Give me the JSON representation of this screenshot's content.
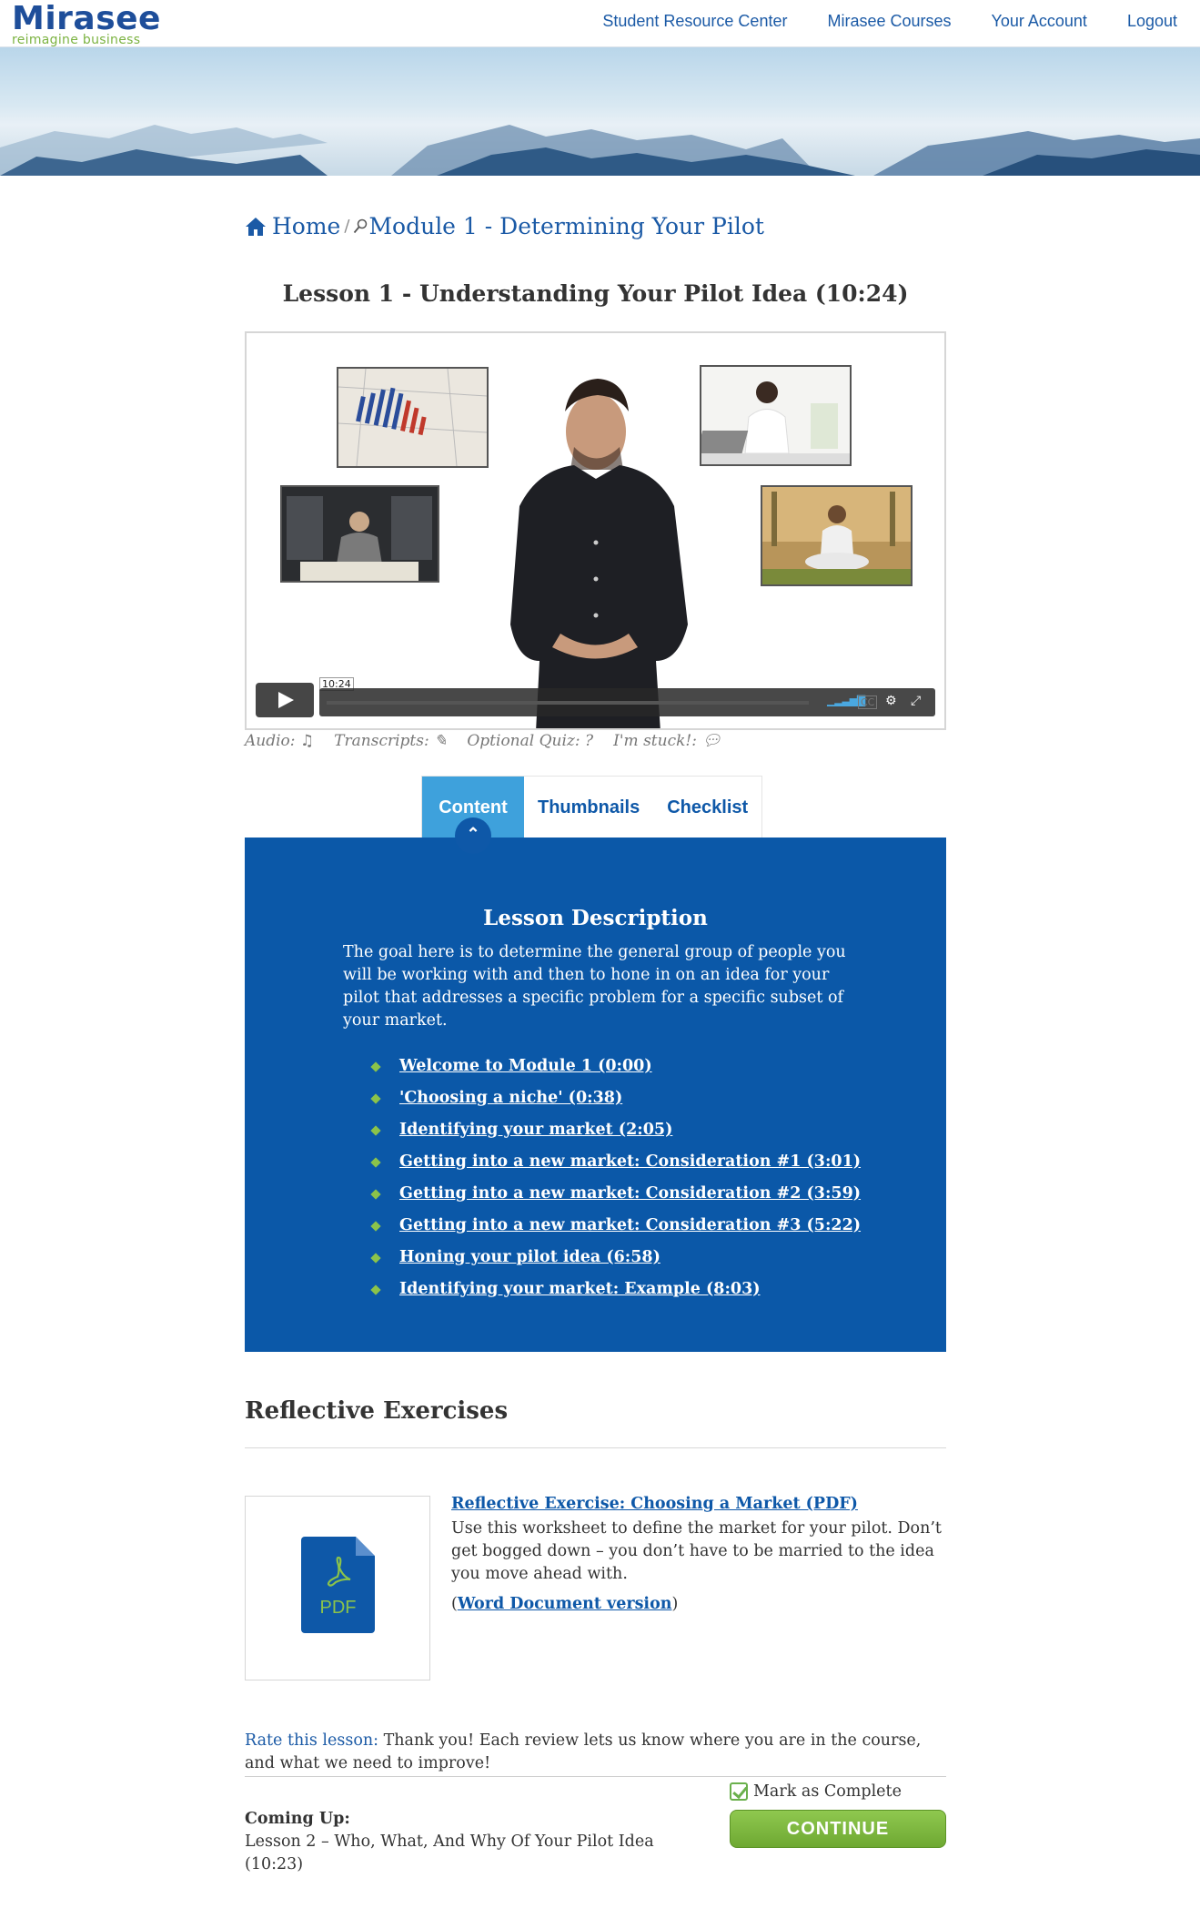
{
  "header": {
    "logo_word": "Mirasee",
    "logo_tagline": "reimagine business",
    "nav": [
      "Student Resource Center",
      "Mirasee Courses",
      "Your Account",
      "Logout"
    ]
  },
  "breadcrumb": {
    "home": "Home",
    "separator": "/",
    "module": "Module 1 - Determining Your Pilot"
  },
  "lesson": {
    "title": "Lesson 1 - Understanding Your Pilot Idea (10:24)"
  },
  "video": {
    "time": "10:24",
    "play_icon": "play-icon",
    "volume_icon": "volume-icon",
    "cc_icon": "captions-icon",
    "settings_icon": "gear-icon",
    "fullscreen_icon": "fullscreen-icon"
  },
  "media_links": {
    "audio": "Audio:",
    "transcripts": "Transcripts:",
    "quiz": "Optional Quiz:",
    "stuck": "I'm stuck!:"
  },
  "tabs": [
    "Content",
    "Thumbnails",
    "Checklist"
  ],
  "content": {
    "title": "Lesson Description",
    "description": "The goal here is to determine the general group of people you will be working with and then to hone in on an idea for your pilot that addresses a specific problem for a specific subset of your market.",
    "chapters": [
      "Welcome to Module 1 (0:00)",
      "'Choosing a niche' (0:38)",
      "Identifying your market (2:05)",
      "Getting into a new market: Consideration #1 (3:01)",
      "Getting into a new market: Consideration #2 (3:59)",
      "Getting into a new market: Consideration #3 (5:22)",
      "Honing your pilot idea (6:58)",
      "Identifying your market: Example (8:03)"
    ]
  },
  "reflective": {
    "heading": "Reflective Exercises",
    "pdf_label": "PDF",
    "link": "Reflective Exercise: Choosing a Market (PDF)",
    "description": "Use this worksheet to define the market for your pilot. Don’t get bogged down – you don’t have to be married to the idea you move ahead with.",
    "word_open": "(",
    "word_link": "Word Document version",
    "word_close": ")"
  },
  "rating": {
    "label": "Rate this lesson:",
    "message": "Thank you! Each review lets us know where you are in the course, and what we need to improve!"
  },
  "footer": {
    "mark_complete": "Mark as Complete",
    "continue": "CONTINUE",
    "coming_up_label": "Coming Up:",
    "coming_up_text": "Lesson 2 – Who, What, And Why Of Your Pilot Idea (10:23)"
  },
  "colors": {
    "brand_blue": "#0b58a8",
    "tab_active": "#3ea1dc",
    "accent_green": "#8bc34a"
  }
}
